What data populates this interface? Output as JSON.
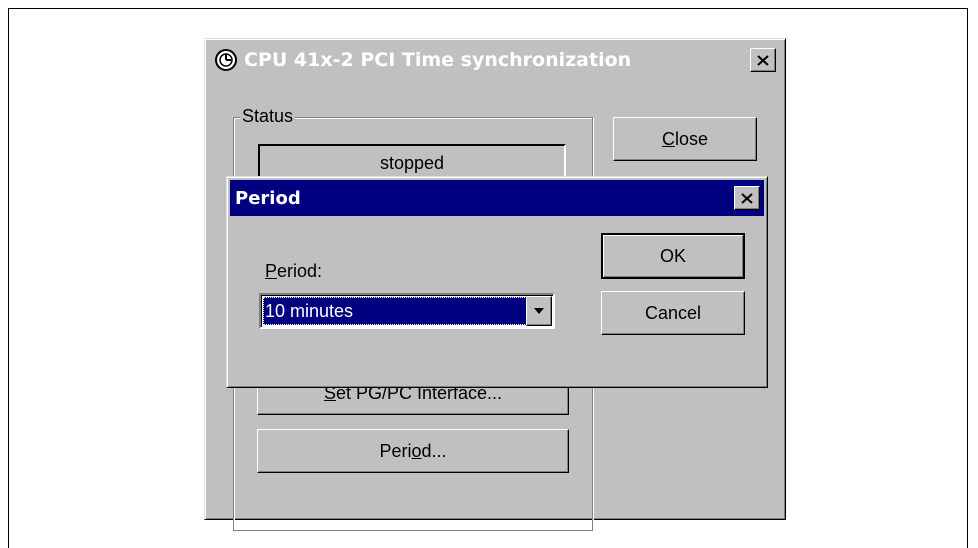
{
  "main_dialog": {
    "title": "CPU 41x-2 PCI Time synchronization",
    "status_group_label": "Status",
    "status_value": "stopped",
    "close_button": {
      "mnemonic": "C",
      "rest": "lose"
    },
    "set_interface_button": {
      "mnemonic": "S",
      "rest": "et PG/PC Interface..."
    },
    "period_button": {
      "before": "Peri",
      "mnemonic": "o",
      "after": "d..."
    }
  },
  "period_dialog": {
    "title": "Period",
    "field_label": {
      "mnemonic": "P",
      "rest": "eriod:"
    },
    "selected_value": "10 minutes",
    "ok_label": "OK",
    "cancel_label": "Cancel"
  },
  "icons": {
    "title_icon": "clock-icon",
    "close": "close-icon",
    "dropdown": "chevron-down-icon"
  },
  "colors": {
    "active_titlebar": "#000080",
    "window_face": "#c0c0c0",
    "selection": "#000080"
  }
}
